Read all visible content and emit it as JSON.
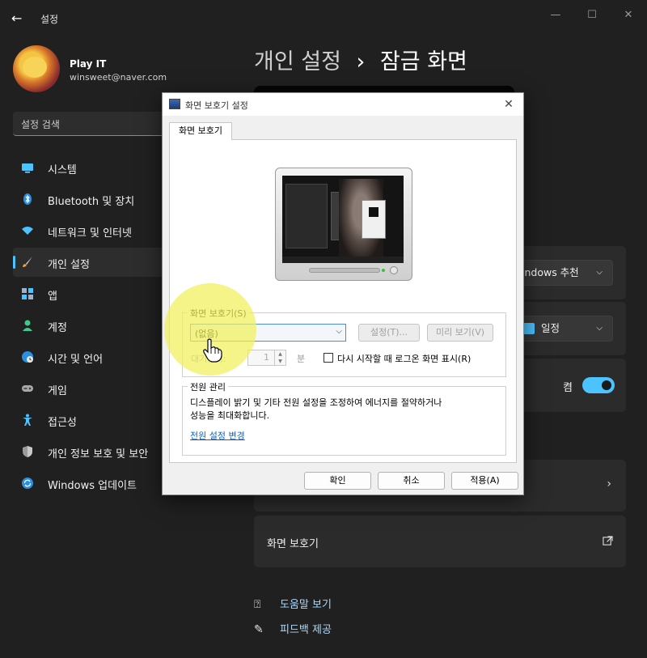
{
  "app": {
    "title": "설정",
    "back_icon": "back-arrow-icon",
    "controls": [
      "minimize-icon",
      "maximize-icon",
      "close-icon"
    ]
  },
  "profile": {
    "name": "Play IT",
    "email": "winsweet@naver.com"
  },
  "search": {
    "placeholder": "설정 검색"
  },
  "sidebar": {
    "items": [
      {
        "label": "시스템",
        "icon": "monitor-icon",
        "active": false
      },
      {
        "label": "Bluetooth 및 장치",
        "icon": "bluetooth-icon",
        "active": false
      },
      {
        "label": "네트워크 및 인터넷",
        "icon": "wifi-icon",
        "active": false
      },
      {
        "label": "개인 설정",
        "icon": "brush-icon",
        "active": true
      },
      {
        "label": "앱",
        "icon": "apps-icon",
        "active": false
      },
      {
        "label": "계정",
        "icon": "person-icon",
        "active": false
      },
      {
        "label": "시간 및 언어",
        "icon": "globe-clock-icon",
        "active": false
      },
      {
        "label": "게임",
        "icon": "gamepad-icon",
        "active": false
      },
      {
        "label": "접근성",
        "icon": "accessibility-icon",
        "active": false
      },
      {
        "label": "개인 정보 보호 및 보안",
        "icon": "shield-icon",
        "active": false
      },
      {
        "label": "Windows 업데이트",
        "icon": "update-icon",
        "active": false
      }
    ],
    "accent": "#4cc2ff"
  },
  "main": {
    "breadcrumb_parent": "개인 설정",
    "breadcrumb_separator": "›",
    "breadcrumb_current": "잠금 화면",
    "background_dropdown": "indows 추천",
    "status_dropdown": "일정",
    "toggle_label": "켬",
    "screensaver_row": "화면 보호기",
    "help_link": "도움말 보기",
    "feedback_link": "피드백 제공"
  },
  "dialog": {
    "title": "화면 보호기 설정",
    "tab": "화면 보호기",
    "screensaver_group": "화면 보호기(S)",
    "screensaver_value": "(없음)",
    "settings_button": "설정(T)...",
    "preview_button": "미리 보기(V)",
    "wait_label": "대기(W):",
    "wait_value": "1",
    "wait_unit": "분",
    "resume_checkbox": "다시 시작할 때 로그온 화면 표시(R)",
    "power_group": "전원 관리",
    "power_desc_line1": "디스플레이 밝기 및 기타 전원 설정을 조정하여 에너지를 절약하거나",
    "power_desc_line2": "성능을 최대화합니다.",
    "power_link": "전원 설정 변경",
    "ok_button": "확인",
    "cancel_button": "취소",
    "apply_button": "적용(A)"
  }
}
